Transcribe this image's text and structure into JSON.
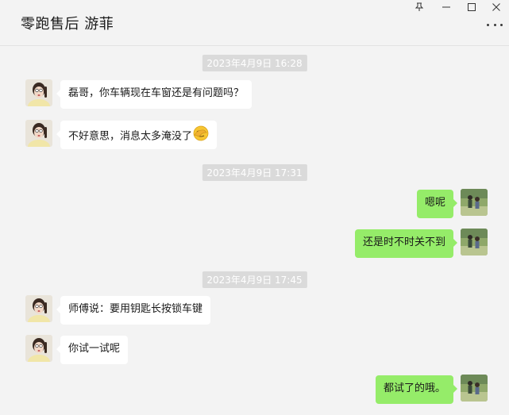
{
  "window": {
    "title": "零跑售后 游菲",
    "controls": [
      "pin-icon",
      "minimize-icon",
      "maximize-icon",
      "close-icon"
    ],
    "more_icon": "more-dots-icon"
  },
  "messages": [
    {
      "type": "timestamp",
      "text": "2023年4月9日 16:28"
    },
    {
      "type": "received",
      "text": "磊哥，你车辆现在车窗还是有问题吗？"
    },
    {
      "type": "received",
      "text": "不好意思，消息太多淹没了",
      "emoji": "facepalm-emoji"
    },
    {
      "type": "timestamp",
      "text": "2023年4月9日 17:31"
    },
    {
      "type": "sent",
      "text": "嗯呢"
    },
    {
      "type": "sent",
      "text": "还是时不时关不到"
    },
    {
      "type": "timestamp",
      "text": "2023年4月9日 17:45"
    },
    {
      "type": "received",
      "text": "师傅说：要用钥匙长按锁车键"
    },
    {
      "type": "received",
      "text": "你试一试呢"
    },
    {
      "type": "sent",
      "text": "都试了的哦。"
    }
  ],
  "colors": {
    "background": "#f3f3f3",
    "sent_bubble": "#95ec69",
    "received_bubble": "#ffffff",
    "timestamp_bg": "#dadada"
  }
}
